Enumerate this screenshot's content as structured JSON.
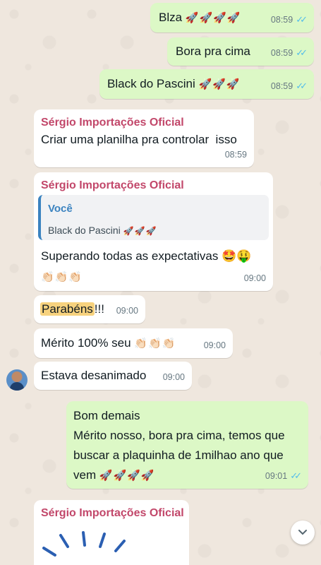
{
  "messages": [
    {
      "text": "Blza",
      "emoji": "🚀🚀🚀🚀",
      "time": "08:59"
    },
    {
      "text": "Bora pra cima",
      "time": "08:59"
    },
    {
      "text": "Black do Pascini",
      "emoji": "🚀🚀🚀",
      "time": "08:59"
    },
    {
      "sender": "Sérgio Importações Oficial",
      "text": "Criar uma planilha pra controlar  isso",
      "time": "08:59"
    },
    {
      "sender": "Sérgio Importações Oficial",
      "quote": {
        "author": "Você",
        "text": "Black do Pascini",
        "emoji": "🚀🚀🚀"
      },
      "text": "Superando todas as expectativas",
      "emoji": "🤩🤑",
      "emoji2": "👏🏻👏🏻👏🏻",
      "time": "09:00"
    },
    {
      "highlight": "Parabéns",
      "text": "!!!",
      "time": "09:00"
    },
    {
      "text": "Mérito 100% seu",
      "emoji": "👏🏻👏🏻👏🏻",
      "time": "09:00"
    },
    {
      "text": "Estava desanimado",
      "time": "09:00"
    },
    {
      "line1": "Bom demais",
      "line2": "Mérito nosso, bora pra cima, temos que",
      "line3": "buscar a plaquinha de 1milhao ano que",
      "line4": "vem",
      "emoji": "🚀🚀🚀🚀",
      "time": "09:01"
    },
    {
      "sender": "Sérgio Importações Oficial"
    }
  ],
  "ticks": "✓✓",
  "scroll_icon": "chevron-down-icon"
}
